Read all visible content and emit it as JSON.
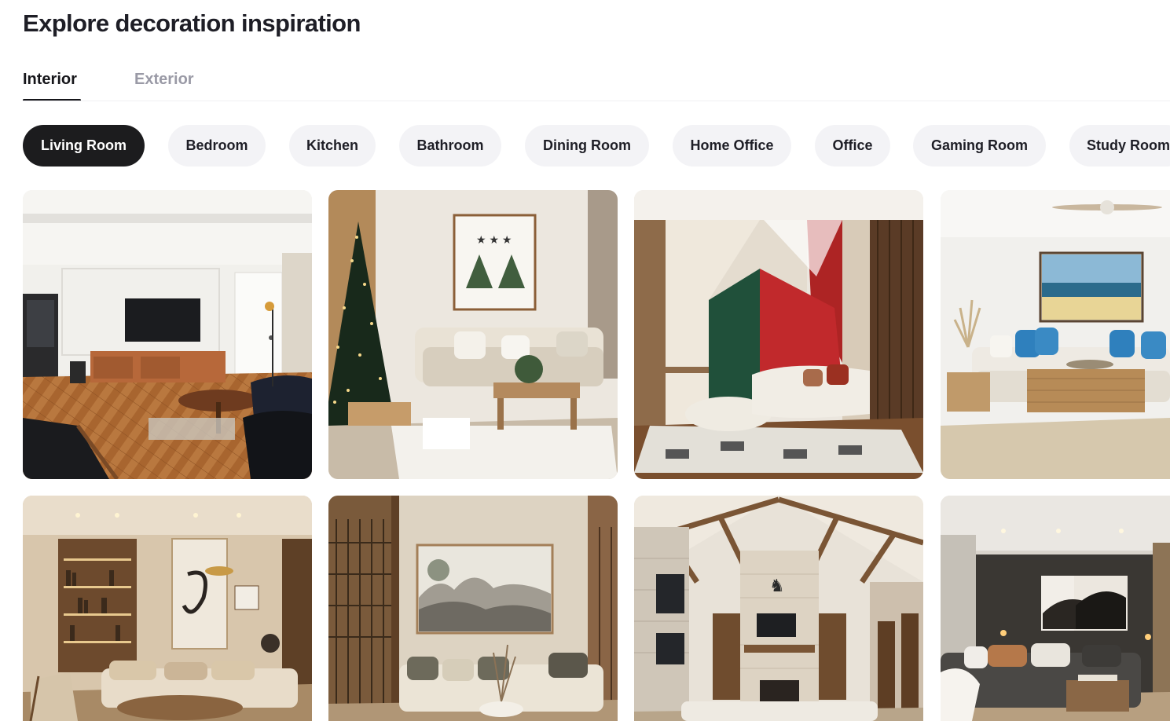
{
  "header": {
    "title": "Explore decoration inspiration"
  },
  "tabs": [
    {
      "label": "Interior",
      "active": true
    },
    {
      "label": "Exterior",
      "active": false
    }
  ],
  "room_filters": [
    {
      "label": "Living Room",
      "selected": true
    },
    {
      "label": "Bedroom",
      "selected": false
    },
    {
      "label": "Kitchen",
      "selected": false
    },
    {
      "label": "Bathroom",
      "selected": false
    },
    {
      "label": "Dining Room",
      "selected": false
    },
    {
      "label": "Home Office",
      "selected": false
    },
    {
      "label": "Office",
      "selected": false
    },
    {
      "label": "Gaming Room",
      "selected": false
    },
    {
      "label": "Study Room",
      "selected": false
    }
  ],
  "gallery": {
    "images": [
      {
        "icon": "living-room-photo-tv-herringbone"
      },
      {
        "icon": "living-room-photo-christmas-tree"
      },
      {
        "icon": "living-room-photo-geometric-wall"
      },
      {
        "icon": "living-room-photo-coastal-painting"
      },
      {
        "icon": "living-room-photo-warm-bookshelf"
      },
      {
        "icon": "living-room-photo-japandi-landscape"
      },
      {
        "icon": "living-room-photo-vaulted-stone-fireplace"
      },
      {
        "icon": "living-room-photo-dark-sectional"
      }
    ]
  },
  "colors": {
    "selected_chip_bg": "#1c1c1e",
    "chip_bg": "#f3f3f6",
    "inactive_tab": "#9a9aa6"
  }
}
